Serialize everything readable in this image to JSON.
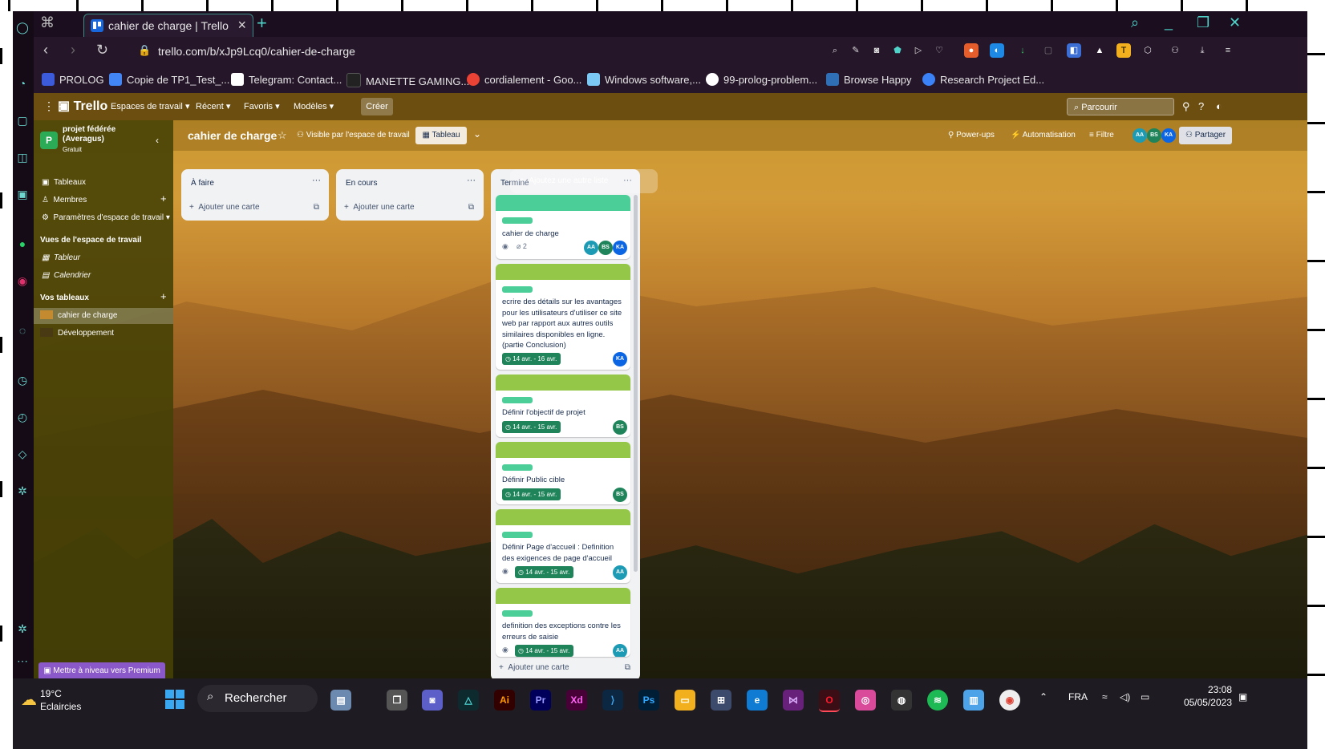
{
  "browser": {
    "tab_title": "cahier de charge | Trello",
    "url": "trello.com/b/xJp9Lcq0/cahier-de-charge",
    "bookmarks": [
      {
        "label": "PROLOG",
        "color": "#3b5bdb"
      },
      {
        "label": "Copie de TP1_Test_...",
        "color": "#4285f4"
      },
      {
        "label": "Telegram: Contact...",
        "color": "#ffffff"
      },
      {
        "label": "MANETTE GAMING...",
        "color": "#222222"
      },
      {
        "label": "cordialement - Goo...",
        "color": "#ea4335"
      },
      {
        "label": "Windows software,...",
        "color": "#7cc8f5"
      },
      {
        "label": "99-prolog-problem...",
        "color": "#ffffff"
      },
      {
        "label": "Browse Happy",
        "color": "#2f6fb5"
      },
      {
        "label": "Research Project Ed...",
        "color": "#3b82f6"
      }
    ]
  },
  "trello": {
    "logo": "Trello",
    "menu": [
      "Espaces de travail",
      "Récent",
      "Favoris",
      "Modèles"
    ],
    "create": "Créer",
    "search_placeholder": "Parcourir",
    "workspace": {
      "initial": "P",
      "name": "projet fédérée (Averagus)",
      "plan": "Gratuit"
    },
    "sidebar_items": [
      "Tableaux",
      "Membres",
      "Paramètres d'espace de travail"
    ],
    "views_heading": "Vues de l'espace de travail",
    "views": [
      "Tableur",
      "Calendrier"
    ],
    "boards_heading": "Vos tableaux",
    "boards": [
      "cahier de charge",
      "Développement"
    ],
    "premium": "Mettre à niveau vers Premium",
    "board": {
      "title": "cahier de charge",
      "visibility": "Visible par l'espace de travail",
      "view": "Tableau",
      "powerups": "Power-ups",
      "automation": "Automatisation",
      "filter": "Filtre",
      "share": "Partager",
      "members": [
        {
          "initials": "AA",
          "color": "#1d9bb4"
        },
        {
          "initials": "BS",
          "color": "#1f845a"
        },
        {
          "initials": "KA",
          "color": "#0c66e4"
        }
      ]
    },
    "lists": [
      {
        "title": "À faire",
        "add": "Ajouter une carte"
      },
      {
        "title": "En cours",
        "add": "Ajouter une carte"
      },
      {
        "title": "Terminé",
        "add": "Ajouter une carte"
      }
    ],
    "add_list": "Ajoutez une autre liste",
    "cards": [
      {
        "text": "cahier de charge",
        "attachments": "2",
        "members": [
          "AA",
          "BS",
          "KA"
        ]
      },
      {
        "text": "ecrire des détails sur les avantages pour les utilisateurs d'utiliser ce site web par rapport aux autres outils similaires disponibles en ligne. (partie Conclusion)",
        "due": "14 avr. - 16 avr.",
        "members": [
          "KA"
        ]
      },
      {
        "text": "Définir l'objectif de projet",
        "due": "14 avr. - 15 avr.",
        "members": [
          "BS"
        ]
      },
      {
        "text": "Définir Public cible",
        "due": "14 avr. - 15 avr.",
        "members": [
          "BS"
        ]
      },
      {
        "text": "Définir Page d'accueil : Definition des exigences de page d'accueil",
        "due": "14 avr. - 15 avr.",
        "members": [
          "AA"
        ]
      },
      {
        "text": "definition des exceptions contre les erreurs de saisie",
        "due": "14 avr. - 15 avr.",
        "members": [
          "AA"
        ]
      }
    ]
  },
  "taskbar": {
    "temperature": "19°C",
    "weather": "Eclaircies",
    "search": "Rechercher",
    "language": "FRA",
    "time": "23:08",
    "date": "05/05/2023"
  }
}
